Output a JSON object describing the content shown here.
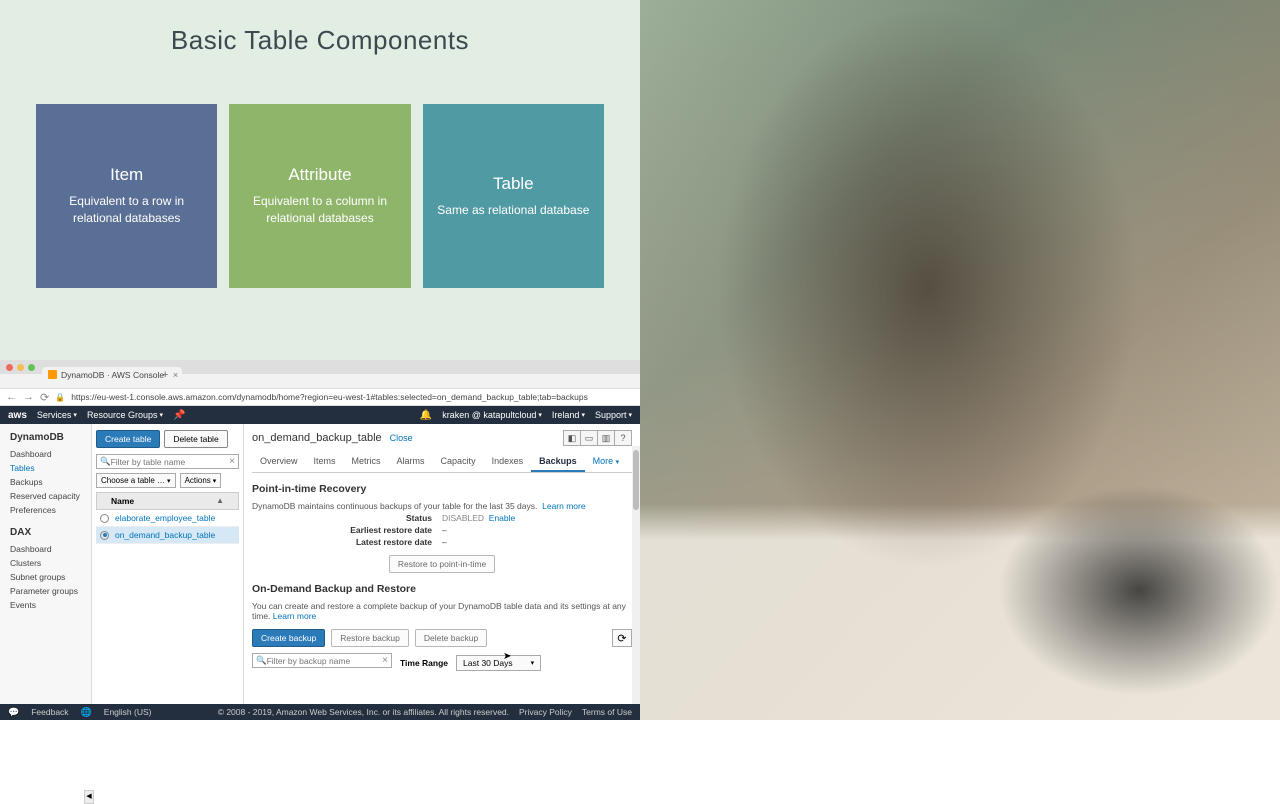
{
  "slide": {
    "title": "Basic Table Components",
    "cards": [
      {
        "title": "Item",
        "desc": "Equivalent to a row in relational databases"
      },
      {
        "title": "Attribute",
        "desc": "Equivalent to a column in relational databases"
      },
      {
        "title": "Table",
        "desc": "Same as relational database"
      }
    ]
  },
  "browser": {
    "tab_title": "DynamoDB · AWS Console",
    "url": "https://eu-west-1.console.aws.amazon.com/dynamodb/home?region=eu-west-1#tables:selected=on_demand_backup_table;tab=backups"
  },
  "aws_header": {
    "logo": "aws",
    "services": "Services",
    "resource_groups": "Resource Groups",
    "account": "kraken @ katapultcloud",
    "region": "Ireland",
    "support": "Support"
  },
  "sidebar": {
    "title1": "DynamoDB",
    "items1": [
      "Dashboard",
      "Tables",
      "Backups",
      "Reserved capacity",
      "Preferences"
    ],
    "active1": "Tables",
    "title2": "DAX",
    "items2": [
      "Dashboard",
      "Clusters",
      "Subnet groups",
      "Parameter groups",
      "Events"
    ]
  },
  "table_panel": {
    "create": "Create table",
    "delete": "Delete table",
    "filter_placeholder": "Filter by table name",
    "group_placeholder": "Choose a table …",
    "actions": "Actions",
    "col_name": "Name",
    "rows": [
      "elaborate_employee_table",
      "on_demand_backup_table"
    ],
    "selected": "on_demand_backup_table"
  },
  "detail": {
    "title": "on_demand_backup_table",
    "close": "Close",
    "tabs": [
      "Overview",
      "Items",
      "Metrics",
      "Alarms",
      "Capacity",
      "Indexes",
      "Backups"
    ],
    "more": "More",
    "active_tab": "Backups",
    "pitr": {
      "heading": "Point-in-time Recovery",
      "desc": "DynamoDB maintains continuous backups of your table for the last 35 days.",
      "learn": "Learn more",
      "status_k": "Status",
      "status_v": "DISABLED",
      "enable": "Enable",
      "earliest_k": "Earliest restore date",
      "earliest_v": "–",
      "latest_k": "Latest restore date",
      "latest_v": "–",
      "restore_btn": "Restore to point-in-time"
    },
    "ondemand": {
      "heading": "On-Demand Backup and Restore",
      "desc": "You can create and restore a complete backup of your DynamoDB table data and its settings at any time.",
      "learn": "Learn more",
      "create": "Create backup",
      "restore": "Restore backup",
      "delete": "Delete backup",
      "filter_placeholder": "Filter by backup name",
      "time_range_label": "Time Range",
      "time_range_value": "Last 30 Days"
    }
  },
  "footer": {
    "feedback": "Feedback",
    "lang": "English (US)",
    "copyright": "© 2008 - 2019, Amazon Web Services, Inc. or its affiliates. All rights reserved.",
    "privacy": "Privacy Policy",
    "terms": "Terms of Use"
  }
}
